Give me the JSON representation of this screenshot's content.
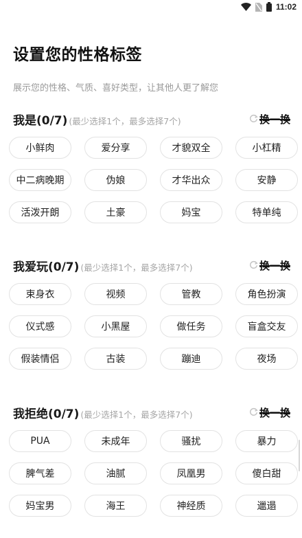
{
  "status_bar": {
    "time": "11:02"
  },
  "header": {
    "title": "设置您的性格标签",
    "subtitle": "展示您的性格、气质、喜好类型，让其他人更了解您"
  },
  "sections": [
    {
      "title": "我是(0/7)",
      "hint": "(最少选择1个，最多选择7个)",
      "refresh_label": "换一换",
      "tags": [
        "小鲜肉",
        "爱分享",
        "才貌双全",
        "小杠精",
        "中二病晚期",
        "伪娘",
        "才华出众",
        "安静",
        "活泼开朗",
        "土豪",
        "妈宝",
        "特单纯"
      ]
    },
    {
      "title": "我爱玩(0/7)",
      "hint": "(最少选择1个，最多选择7个)",
      "refresh_label": "换一换",
      "tags": [
        "束身衣",
        "视频",
        "管教",
        "角色扮演",
        "仪式感",
        "小黑屋",
        "做任务",
        "盲盒交友",
        "假装情侣",
        "古装",
        "蹦迪",
        "夜场"
      ]
    },
    {
      "title": "我拒绝(0/7)",
      "hint": "(最少选择1个，最多选择7个)",
      "refresh_label": "换一换",
      "tags": [
        "PUA",
        "未成年",
        "骚扰",
        "暴力",
        "脾气差",
        "油腻",
        "凤凰男",
        "傻白甜",
        "妈宝男",
        "海王",
        "神经质",
        "邋遢"
      ]
    }
  ]
}
